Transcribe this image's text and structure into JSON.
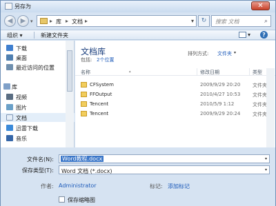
{
  "window": {
    "title": "另存为",
    "close_glyph": "✕"
  },
  "nav": {
    "back_glyph": "◀",
    "forward_glyph": "▶",
    "history_glyph": "▾",
    "path": [
      "库",
      "文档"
    ],
    "sep_glyph": "▸",
    "addr_drop_glyph": "▾",
    "refresh_glyph": "↻",
    "search_placeholder": "搜索 文档",
    "search_glyph": "⌕"
  },
  "toolbar": {
    "organize_label": "组织 ▾",
    "new_folder_label": "新建文件夹",
    "view_drop": "▾",
    "help_glyph": "?"
  },
  "sidebar": {
    "items": [
      {
        "label": "下载",
        "icon": "download-folder-icon",
        "color": "#3f7fcf"
      },
      {
        "label": "桌面",
        "icon": "desktop-icon",
        "color": "#4f7fb0"
      },
      {
        "label": "最近访问的位置",
        "icon": "recent-places-icon",
        "color": "#6f8fae"
      },
      {
        "label": "库",
        "icon": "libraries-icon",
        "color": "#7fa0c8"
      },
      {
        "label": "视频",
        "icon": "videos-icon",
        "color": "#5a6d82"
      },
      {
        "label": "图片",
        "icon": "pictures-icon",
        "color": "#6aa0c8"
      },
      {
        "label": "文档",
        "icon": "documents-icon",
        "color": "#e5eef8"
      },
      {
        "label": "迅雷下载",
        "icon": "thunder-download-icon",
        "color": "#3b8ad9"
      },
      {
        "label": "音乐",
        "icon": "music-icon",
        "color": "#3566a8"
      }
    ]
  },
  "library": {
    "title": "文档库",
    "includes_label": "包括:",
    "locations": "2个位置",
    "arrange_label": "排列方式:",
    "arrange_value": "文件夹",
    "arrange_drop": "▾"
  },
  "columns": {
    "name": "名称",
    "sort_caret": "▴",
    "date": "修改日期",
    "type": "类型"
  },
  "files": [
    {
      "name": "CFSystem",
      "date": "2009/9/29 20:20",
      "type": "文件夹"
    },
    {
      "name": "FFOutput",
      "date": "2010/4/27 10:53",
      "type": "文件夹"
    },
    {
      "name": "Tencent",
      "date": "2010/5/9 1:12",
      "type": "文件夹"
    },
    {
      "name": "Tencent",
      "date": "2009/9/29 20:24",
      "type": "文件夹"
    }
  ],
  "form": {
    "filename_label": "文件名(N):",
    "filename_value": "Word教程.docx",
    "filetype_label": "保存类型(T):",
    "filetype_value": "Word 文档 (*.docx)",
    "drop_glyph": "▾",
    "author_label": "作者:",
    "author_value": "Administrator",
    "tags_label": "标记:",
    "tags_value": "添加标记",
    "thumbnail_label": "保存缩略图"
  },
  "colors": {
    "accent": "#1c5ab9",
    "folder": "#f2cd5c",
    "selection": "#3a76c8"
  }
}
